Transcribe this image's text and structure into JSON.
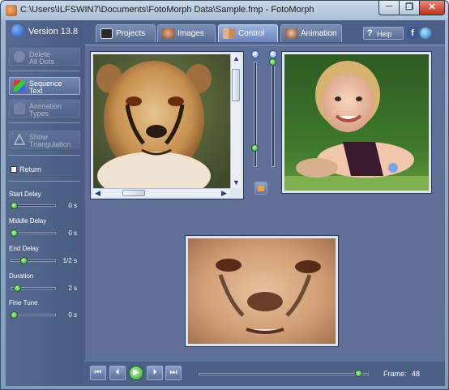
{
  "window": {
    "title": "C:\\Users\\ILFSWIN7\\Documents\\FotoMorph Data\\Sample.fmp - FotoMorph",
    "minimize": "─",
    "maximize": "❐",
    "close": "✕"
  },
  "left_panel": {
    "version": "Version 13.8",
    "buttons": [
      {
        "label": "Delete\nAll Dots",
        "enabled": false
      },
      {
        "label": "Sequence\nText",
        "enabled": true
      },
      {
        "label": "Animation\nTypes",
        "enabled": false
      },
      {
        "label": "Show\nTriangulation",
        "enabled": false
      }
    ],
    "return_label": "Return",
    "return_checked": false,
    "sliders": [
      {
        "label": "Start Delay",
        "value": "0 s",
        "level": 0.0
      },
      {
        "label": "Middle Delay",
        "value": "0 s",
        "level": 0.0
      },
      {
        "label": "End Delay",
        "value": "1/2 s",
        "level": 0.35
      },
      {
        "label": "Duration",
        "value": "2 s",
        "level": 0.15
      },
      {
        "label": "Fine Tune",
        "value": "0 s",
        "level": 0.0
      }
    ]
  },
  "tabs": [
    {
      "label": "Projects",
      "active": false
    },
    {
      "label": "Images",
      "active": false
    },
    {
      "label": "Control",
      "active": true
    },
    {
      "label": "Animation",
      "active": false
    }
  ],
  "help": {
    "label": "Help",
    "q": "?"
  },
  "facebook": "f",
  "playback": {
    "first": "⏮",
    "prev": "⏴",
    "play": "▶",
    "next": "⏵",
    "last": "⏭",
    "frame_label": "Frame:",
    "frame_value": "48",
    "progress": 0.96
  },
  "colors": {
    "accent": "#6b86bf",
    "slider_knob": "#2e9e2a"
  }
}
